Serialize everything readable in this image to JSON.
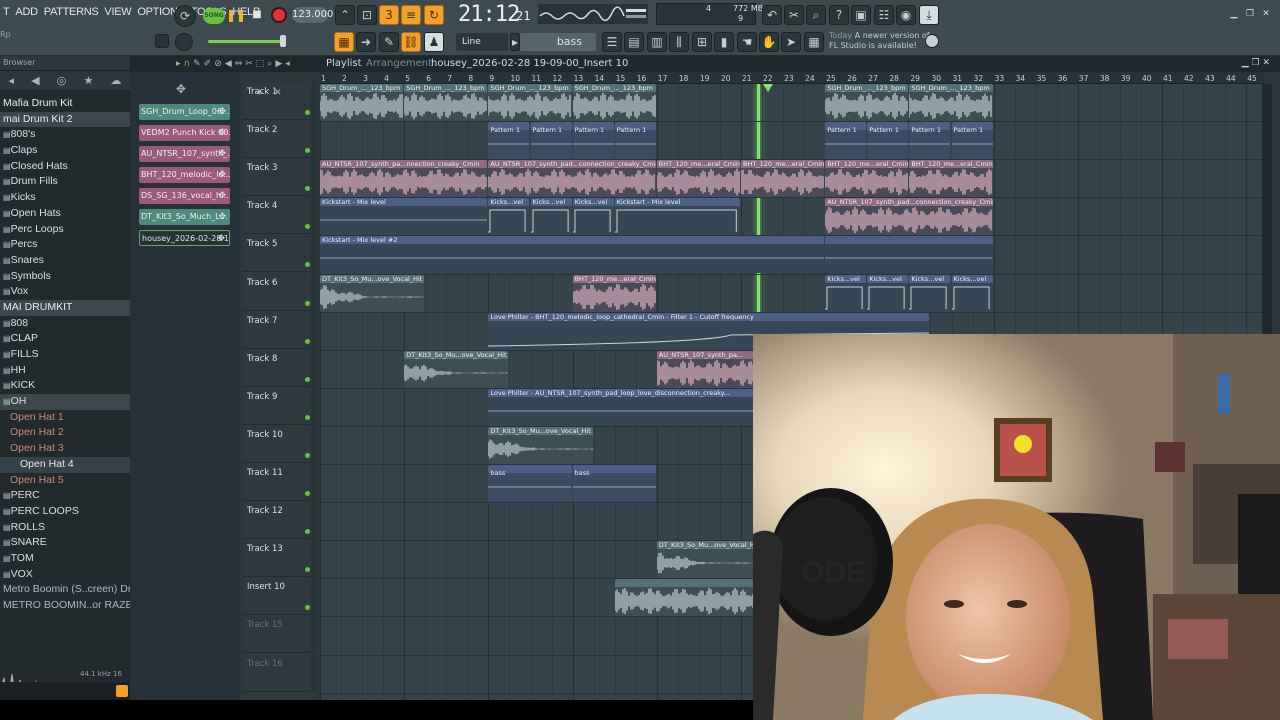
{
  "menu": [
    "T",
    "ADD",
    "PATTERNS",
    "VIEW",
    "OPTIONS",
    "TOOLS",
    "HELP"
  ],
  "transport": {
    "mode": "SONG",
    "tempo": "123.000",
    "clock": "21:12",
    "clock_frac": "21",
    "cpu_count": "4",
    "mem": "772 MB",
    "cpu_count2": "9"
  },
  "toolbar2": {
    "hint": "Rp",
    "snap": "Line",
    "pattern": "bass"
  },
  "news": {
    "today": "Today",
    "msg": "A newer version of FL Studio is available!"
  },
  "browser": {
    "title": "Browser",
    "items": [
      {
        "label": "Mafia Drum Kit",
        "kind": "root"
      },
      {
        "label": "mai Drum Kit 2",
        "kind": "root sel"
      },
      {
        "label": "808's",
        "kind": "folder"
      },
      {
        "label": "Claps",
        "kind": "folder"
      },
      {
        "label": "Closed Hats",
        "kind": "folder"
      },
      {
        "label": "Drum Fills",
        "kind": "folder"
      },
      {
        "label": "Kicks",
        "kind": "folder"
      },
      {
        "label": "Open Hats",
        "kind": "folder"
      },
      {
        "label": "Perc Loops",
        "kind": "folder"
      },
      {
        "label": "Percs",
        "kind": "folder"
      },
      {
        "label": "Snares",
        "kind": "folder"
      },
      {
        "label": "Symbols",
        "kind": "folder"
      },
      {
        "label": "Vox",
        "kind": "folder"
      },
      {
        "label": "MAI DRUMKIT",
        "kind": "root sel"
      },
      {
        "label": "808",
        "kind": "folder"
      },
      {
        "label": "CLAP",
        "kind": "folder"
      },
      {
        "label": "FILLS",
        "kind": "folder"
      },
      {
        "label": "HH",
        "kind": "folder"
      },
      {
        "label": "KICK",
        "kind": "folder"
      },
      {
        "label": "OH",
        "kind": "folder sel"
      },
      {
        "label": "Open Hat 1",
        "kind": "sub"
      },
      {
        "label": "Open Hat 2",
        "kind": "sub"
      },
      {
        "label": "Open Hat 3",
        "kind": "sub"
      },
      {
        "label": "Open Hat 4",
        "kind": "sub2"
      },
      {
        "label": "Open Hat 5",
        "kind": "sub"
      },
      {
        "label": "PERC",
        "kind": "folder"
      },
      {
        "label": "PERC LOOPS",
        "kind": "folder"
      },
      {
        "label": "ROLLS",
        "kind": "folder"
      },
      {
        "label": "SNARE",
        "kind": "folder"
      },
      {
        "label": "TOM",
        "kind": "folder"
      },
      {
        "label": "VOX",
        "kind": "folder"
      },
      {
        "label": "Metro Boomin (S..creen) Drumkit",
        "kind": "dim"
      },
      {
        "label": "METRO BOOMIN..or RAZER MUSIC",
        "kind": "dim"
      }
    ],
    "sample_info": "44.1 kHz 16"
  },
  "playlist": {
    "title": "Playlist",
    "mode": "Arrangement",
    "project": "housey_2026-02-28 19-09-00_Insert 10",
    "patterns": [
      {
        "label": "SGH_Drum_Loop_06...",
        "kind": "bt"
      },
      {
        "label": "VEDM2 Punch Kick 00...",
        "kind": "pk"
      },
      {
        "label": "AU_NTSR_107_synth_...",
        "kind": "pk"
      },
      {
        "label": "BHT_120_melodic_lo...",
        "kind": "pk"
      },
      {
        "label": "DS_SG_136_vocal_h...",
        "kind": "pk"
      },
      {
        "label": "DT_Kit3_So_Much_L...",
        "kind": "bt"
      },
      {
        "label": "housey_2026-02-28 19-...",
        "kind": "sel"
      }
    ],
    "tracks": [
      {
        "name": "Track 1",
        "active": true
      },
      {
        "name": "Track 2",
        "active": true
      },
      {
        "name": "Track 3",
        "active": true
      },
      {
        "name": "Track 4",
        "active": true
      },
      {
        "name": "Track 5",
        "active": true
      },
      {
        "name": "Track 6",
        "active": true
      },
      {
        "name": "Track 7",
        "active": true
      },
      {
        "name": "Track 8",
        "active": true
      },
      {
        "name": "Track 9",
        "active": true
      },
      {
        "name": "Track 10",
        "active": true
      },
      {
        "name": "Track 11",
        "active": true
      },
      {
        "name": "Track 12",
        "active": true
      },
      {
        "name": "Track 13",
        "active": true
      },
      {
        "name": "Insert 10",
        "active": true
      },
      {
        "name": "Track 15",
        "active": false
      },
      {
        "name": "Track 16",
        "active": false
      }
    ],
    "ruler": [
      "1",
      "2",
      "3",
      "4",
      "5",
      "6",
      "7",
      "8",
      "9",
      "10",
      "11",
      "12",
      "13",
      "14",
      "15",
      "16",
      "17",
      "18",
      "19",
      "20",
      "21",
      "22",
      "23",
      "24",
      "25",
      "26",
      "27",
      "28",
      "29",
      "30",
      "31",
      "32",
      "33",
      "34",
      "35",
      "36",
      "37",
      "38",
      "39",
      "40",
      "41",
      "42",
      "43",
      "44",
      "45"
    ],
    "clips": [
      {
        "track": 1,
        "start": 1,
        "len": 4,
        "kind": "audio-g",
        "label": "SGH_Drum_..._123_bpm",
        "wave": true
      },
      {
        "track": 1,
        "start": 5,
        "len": 4,
        "kind": "audio-g",
        "label": "SGH_Drum_..._123_bpm",
        "wave": true
      },
      {
        "track": 1,
        "start": 9,
        "len": 4,
        "kind": "audio-g",
        "label": "SGH_Drum_..._123_bpm",
        "wave": true
      },
      {
        "track": 1,
        "start": 13,
        "len": 4,
        "kind": "audio-g",
        "label": "SGH_Drum_..._123_bpm",
        "wave": true
      },
      {
        "track": 1,
        "start": 25,
        "len": 4,
        "kind": "audio-g",
        "label": "SGH_Drum_..._123_bpm",
        "wave": true
      },
      {
        "track": 1,
        "start": 29,
        "len": 4,
        "kind": "audio-g",
        "label": "SGH_Drum_..._123_bpm",
        "wave": true
      },
      {
        "track": 2,
        "start": 9,
        "len": 2,
        "kind": "pat",
        "label": "Pattern 1"
      },
      {
        "track": 2,
        "start": 11,
        "len": 2,
        "kind": "pat",
        "label": "Pattern 1"
      },
      {
        "track": 2,
        "start": 13,
        "len": 2,
        "kind": "pat",
        "label": "Pattern 1"
      },
      {
        "track": 2,
        "start": 15,
        "len": 2,
        "kind": "pat",
        "label": "Pattern 1"
      },
      {
        "track": 2,
        "start": 25,
        "len": 2,
        "kind": "pat",
        "label": "Pattern 1"
      },
      {
        "track": 2,
        "start": 27,
        "len": 2,
        "kind": "pat",
        "label": "Pattern 1"
      },
      {
        "track": 2,
        "start": 29,
        "len": 2,
        "kind": "pat",
        "label": "Pattern 1"
      },
      {
        "track": 2,
        "start": 31,
        "len": 2,
        "kind": "pat",
        "label": "Pattern 1"
      },
      {
        "track": 3,
        "start": 1,
        "len": 8,
        "kind": "audio-p",
        "label": "AU_NTSR_107_synth_pa...nnection_creaky_Cmin",
        "wave": true
      },
      {
        "track": 3,
        "start": 9,
        "len": 8,
        "kind": "audio-p",
        "label": "AU_NTSR_107_synth_pad...connection_creaky_Cmin",
        "wave": true
      },
      {
        "track": 3,
        "start": 17,
        "len": 4,
        "kind": "audio-p",
        "label": "BHT_120_me...eral_Cmin",
        "wave": true
      },
      {
        "track": 3,
        "start": 21,
        "len": 4,
        "kind": "audio-p",
        "label": "BHT_120_me...eral_Cmin",
        "wave": true
      },
      {
        "track": 3,
        "start": 25,
        "len": 4,
        "kind": "audio-p",
        "label": "BHT_120_me...eral_Cmin",
        "wave": true
      },
      {
        "track": 3,
        "start": 29,
        "len": 4,
        "kind": "audio-p",
        "label": "BHT_120_me...eral_Cmin",
        "wave": true
      },
      {
        "track": 4,
        "start": 1,
        "len": 8,
        "kind": "auto",
        "label": "Kickstart - Mix level"
      },
      {
        "track": 4,
        "start": 9,
        "len": 2,
        "kind": "auto",
        "label": "Kicks...vel",
        "steps": true
      },
      {
        "track": 4,
        "start": 11,
        "len": 2,
        "kind": "auto",
        "label": "Kicks...vel",
        "steps": true
      },
      {
        "track": 4,
        "start": 13,
        "len": 2,
        "kind": "auto",
        "label": "Kicks...vel",
        "steps": true
      },
      {
        "track": 4,
        "start": 15,
        "len": 6,
        "kind": "auto",
        "label": "Kickstart - Mix level",
        "steps": true
      },
      {
        "track": 4,
        "start": 25,
        "len": 8,
        "kind": "audio-p",
        "label": "AU_NTSR_107_synth_pad...connection_creaky_Cmin",
        "wave": true
      },
      {
        "track": 5,
        "start": 1,
        "len": 24,
        "kind": "auto",
        "label": "Kickstart - Mix level #2"
      },
      {
        "track": 5,
        "start": 25,
        "len": 8,
        "kind": "auto",
        "label": ""
      },
      {
        "track": 6,
        "start": 1,
        "len": 5,
        "kind": "audio-g",
        "label": "DT_Kit3_So_Mu...ove_Vocal_Hit",
        "wave": true,
        "decay": true
      },
      {
        "track": 6,
        "start": 13,
        "len": 4,
        "kind": "audio-p",
        "label": "BHT_120_me...eral_Cmin",
        "wave": true
      },
      {
        "track": 6,
        "start": 25,
        "len": 2,
        "kind": "auto",
        "label": "Kicks...vel",
        "steps": true
      },
      {
        "track": 6,
        "start": 27,
        "len": 2,
        "kind": "auto",
        "label": "Kicks...vel",
        "steps": true
      },
      {
        "track": 6,
        "start": 29,
        "len": 2,
        "kind": "auto",
        "label": "Kicks...vel",
        "steps": true
      },
      {
        "track": 6,
        "start": 31,
        "len": 2,
        "kind": "auto",
        "label": "Kicks...vel",
        "steps": true
      },
      {
        "track": 7,
        "start": 9,
        "len": 21,
        "kind": "auto",
        "label": "Love Philter - BHT_120_melodic_loop_cathedral_Cmin - Filter 1 - Cutoff frequency",
        "ramp": true
      },
      {
        "track": 8,
        "start": 5,
        "len": 5,
        "kind": "audio-g",
        "label": "DT_Kit3_So_Mu...ove_Vocal_Hit",
        "wave": true,
        "decay": true
      },
      {
        "track": 8,
        "start": 17,
        "len": 5,
        "kind": "audio-p",
        "label": "AU_NTSR_107_synth_pa...",
        "wave": true
      },
      {
        "track": 9,
        "start": 9,
        "len": 13,
        "kind": "auto",
        "label": "Love Philter - AU_NTSR_107_synth_pad_loop_love_disconnection_creaky..."
      },
      {
        "track": 10,
        "start": 9,
        "len": 5,
        "kind": "audio-g",
        "label": "DT_Kit3_So_Mu...ove_Vocal_Hit",
        "wave": true,
        "decay": true
      },
      {
        "track": 11,
        "start": 9,
        "len": 4,
        "kind": "pat",
        "label": "bass"
      },
      {
        "track": 11,
        "start": 13,
        "len": 4,
        "kind": "pat",
        "label": "bass"
      },
      {
        "track": 13,
        "start": 17,
        "len": 5,
        "kind": "audio-g",
        "label": "DT_Kit3_So_Mu...ove_Vocal_Hit",
        "wave": true,
        "decay": true
      },
      {
        "track": 14,
        "start": 15,
        "len": 7,
        "kind": "audio-g",
        "label": "",
        "wave": true
      }
    ]
  },
  "colors": {
    "accent": "#f3a02a",
    "playhead": "#86e46a",
    "record": "#e0323a",
    "track_led": "#6cc040"
  }
}
